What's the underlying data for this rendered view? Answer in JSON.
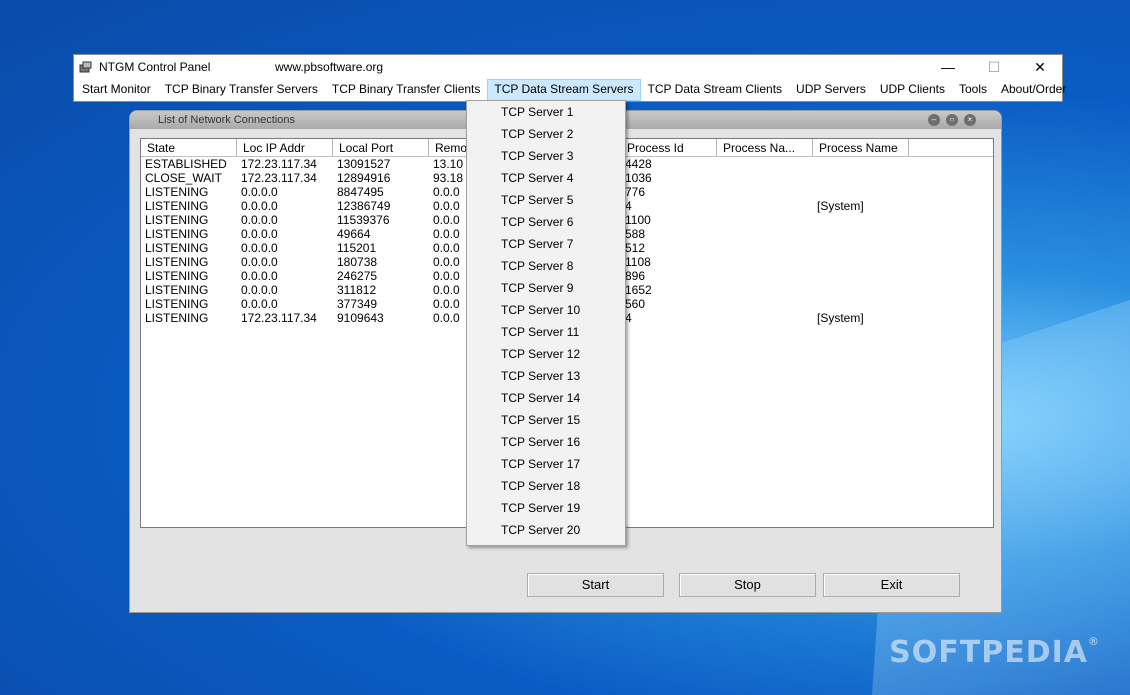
{
  "window": {
    "title": "NTGM Control Panel",
    "url": "www.pbsoftware.org",
    "minimize_glyph": "—",
    "maximize_glyph": "☐",
    "close_glyph": "✕"
  },
  "menu": [
    {
      "label": "Start Monitor"
    },
    {
      "label": "TCP Binary Transfer Servers"
    },
    {
      "label": "TCP Binary Transfer Clients"
    },
    {
      "label": "TCP Data Stream Servers",
      "active": true
    },
    {
      "label": "TCP Data Stream Clients"
    },
    {
      "label": "UDP Servers"
    },
    {
      "label": "UDP Clients"
    },
    {
      "label": "Tools"
    },
    {
      "label": "About/Order"
    }
  ],
  "child_window": {
    "title": "List of Network Connections"
  },
  "list": {
    "columns": [
      "State",
      "Loc IP Addr",
      "Local Port",
      "Remo",
      "",
      "Process Id",
      "Process Na...",
      "Process Name"
    ],
    "rows": [
      [
        "ESTABLISHED",
        "172.23.117.34",
        "13091527",
        "13.10",
        "",
        "4428",
        "",
        ""
      ],
      [
        "CLOSE_WAIT",
        "172.23.117.34",
        "12894916",
        "93.18",
        "",
        "1036",
        "",
        ""
      ],
      [
        "LISTENING",
        "0.0.0.0",
        "8847495",
        "0.0.0",
        "",
        "776",
        "",
        ""
      ],
      [
        "LISTENING",
        "0.0.0.0",
        "12386749",
        "0.0.0",
        "",
        "4",
        "",
        "[System]"
      ],
      [
        "LISTENING",
        "0.0.0.0",
        "11539376",
        "0.0.0",
        "",
        "1100",
        "",
        ""
      ],
      [
        "LISTENING",
        "0.0.0.0",
        "49664",
        "0.0.0",
        "",
        "588",
        "",
        ""
      ],
      [
        "LISTENING",
        "0.0.0.0",
        "115201",
        "0.0.0",
        "",
        "512",
        "",
        ""
      ],
      [
        "LISTENING",
        "0.0.0.0",
        "180738",
        "0.0.0",
        "",
        "1108",
        "",
        ""
      ],
      [
        "LISTENING",
        "0.0.0.0",
        "246275",
        "0.0.0",
        "",
        "896",
        "",
        ""
      ],
      [
        "LISTENING",
        "0.0.0.0",
        "311812",
        "0.0.0",
        "",
        "1652",
        "",
        ""
      ],
      [
        "LISTENING",
        "0.0.0.0",
        "377349",
        "0.0.0",
        "",
        "560",
        "",
        ""
      ],
      [
        "LISTENING",
        "172.23.117.34",
        "9109643",
        "0.0.0",
        "",
        "4",
        "",
        "[System]"
      ]
    ]
  },
  "buttons": {
    "start": "Start",
    "stop": "Stop",
    "exit": "Exit"
  },
  "dropdown_items": [
    "TCP Server 1",
    "TCP Server 2",
    "TCP Server 3",
    "TCP Server 4",
    "TCP Server 5",
    "TCP Server 6",
    "TCP Server 7",
    "TCP Server 8",
    "TCP Server 9",
    "TCP Server 10",
    "TCP Server 11",
    "TCP Server 12",
    "TCP Server 13",
    "TCP Server 14",
    "TCP Server 15",
    "TCP Server 16",
    "TCP Server 17",
    "TCP Server 18",
    "TCP Server 19",
    "TCP Server 20"
  ],
  "watermark": "SOFTPEDIA"
}
